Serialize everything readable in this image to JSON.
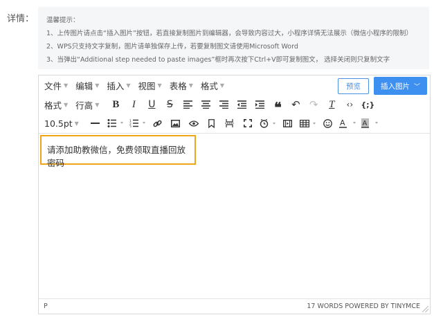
{
  "form": {
    "field_label": "详情："
  },
  "tips": {
    "title": "温馨提示：",
    "lines": [
      "1、上传图片请点击“插入图片”按钮，若直接复制图片到编辑器，会导致内容过大，小程序详情无法展示（微信小程序的限制）",
      "2、WPS只支持文字复制，图片请单独保存上传，若要复制图文请使用Microsoft Word",
      "3、当弹出“Additional step needed to paste images”框时再次按下Ctrl+V即可复制图文， 选择关闭则只复制文字"
    ]
  },
  "editor": {
    "menus": [
      "文件",
      "编辑",
      "插入",
      "视图",
      "表格",
      "格式"
    ],
    "preview_label": "预览",
    "insert_image_label": "插入图片",
    "format_label": "格式",
    "line_height_label": "行高",
    "font_size_value": "10.5pt",
    "content_text": "请添加助教微信，免费领取直播回放密码",
    "status_path": "P",
    "status_words": "17 WORDS POWERED BY TINYMCE"
  },
  "colors": {
    "accent_blue": "#3d8ff0",
    "highlight_border": "#f0a418",
    "tips_bg": "#f5f6f8"
  }
}
